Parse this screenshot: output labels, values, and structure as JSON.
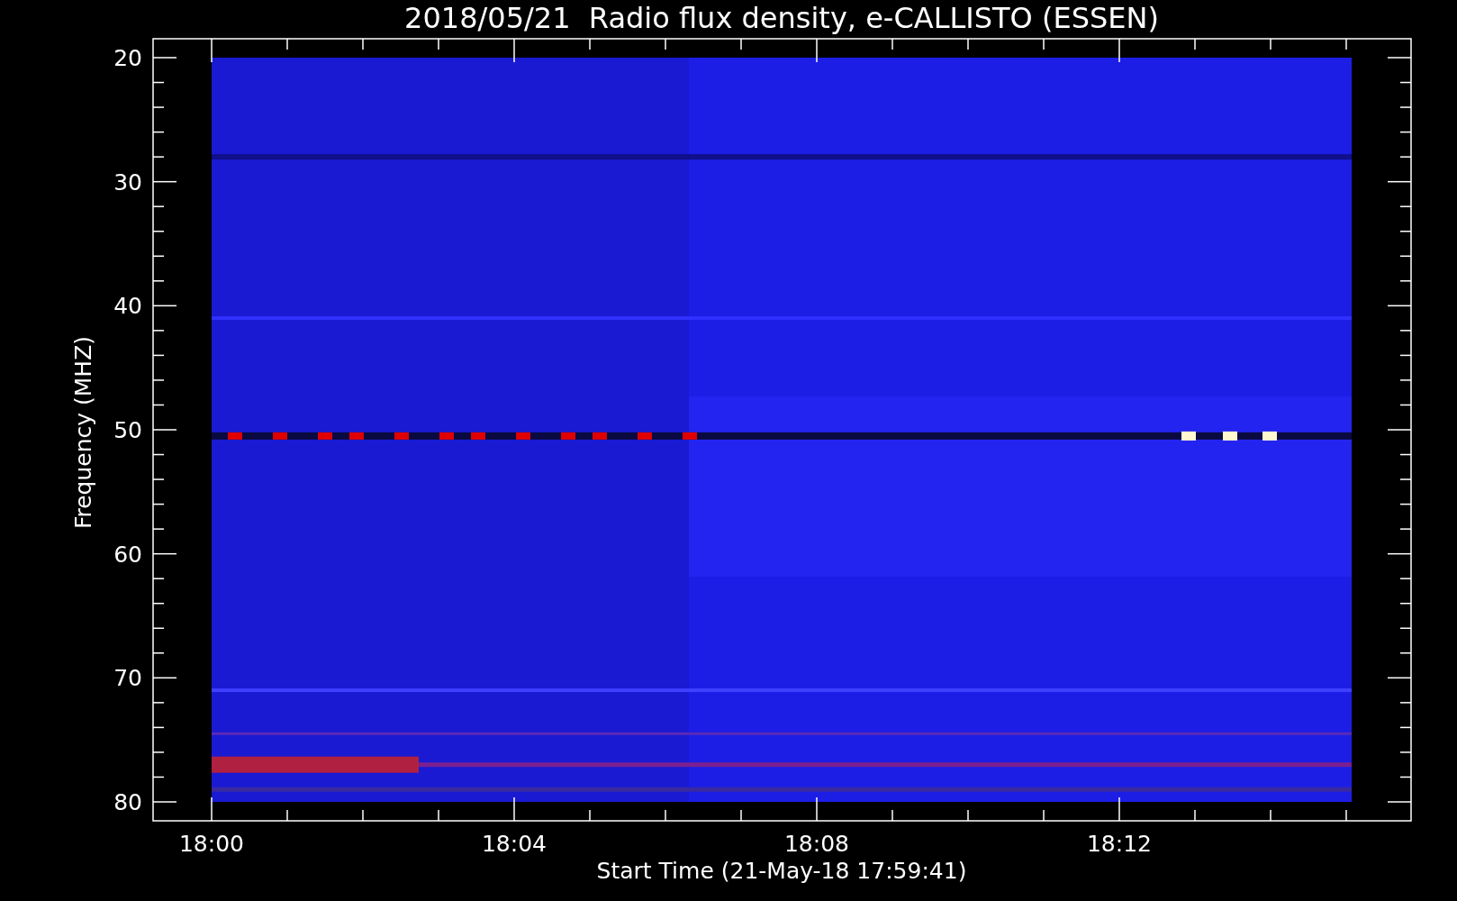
{
  "title": "2018/05/21  Radio flux density, e-CALLISTO (ESSEN)",
  "y_axis": {
    "label": "Frequency (MHZ)",
    "ticks": [
      "20",
      "30",
      "40",
      "50",
      "60",
      "70",
      "80"
    ]
  },
  "x_axis": {
    "label": "Start Time (21-May-18 17:59:41)",
    "ticks": [
      "18:00",
      "18:04",
      "18:08",
      "18:12"
    ]
  }
}
